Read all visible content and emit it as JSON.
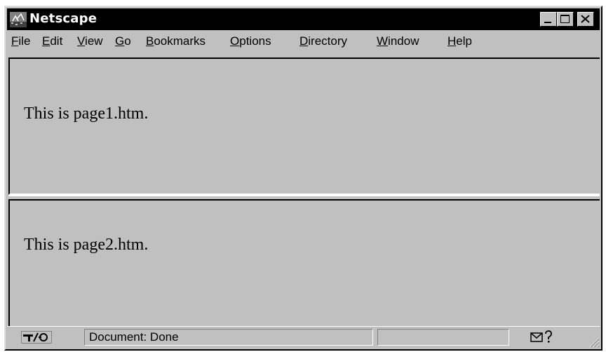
{
  "window": {
    "title": "Netscape"
  },
  "menu": {
    "items": [
      {
        "label_ul": "F",
        "label_rest": "ile"
      },
      {
        "label_ul": "E",
        "label_rest": "dit"
      },
      {
        "label_ul": "V",
        "label_rest": "iew"
      },
      {
        "label_ul": "G",
        "label_rest": "o"
      },
      {
        "label_ul": "B",
        "label_rest": "ookmarks"
      },
      {
        "label_ul": "O",
        "label_rest": "ptions"
      },
      {
        "label_ul": "D",
        "label_rest": "irectory"
      },
      {
        "label_ul": "W",
        "label_rest": "indow"
      },
      {
        "label_ul": "H",
        "label_rest": "elp"
      }
    ]
  },
  "frames": {
    "top_text": "This is page1.htm.",
    "bottom_text": "This is page2.htm."
  },
  "status": {
    "text": "Document: Done"
  },
  "icons": {
    "app": "netscape-app-icon",
    "minimize": "minimize-icon",
    "maximize": "maximize-icon",
    "close": "close-icon",
    "security": "security-key-icon",
    "mail": "mail-icon",
    "resize": "resize-grip-icon"
  }
}
